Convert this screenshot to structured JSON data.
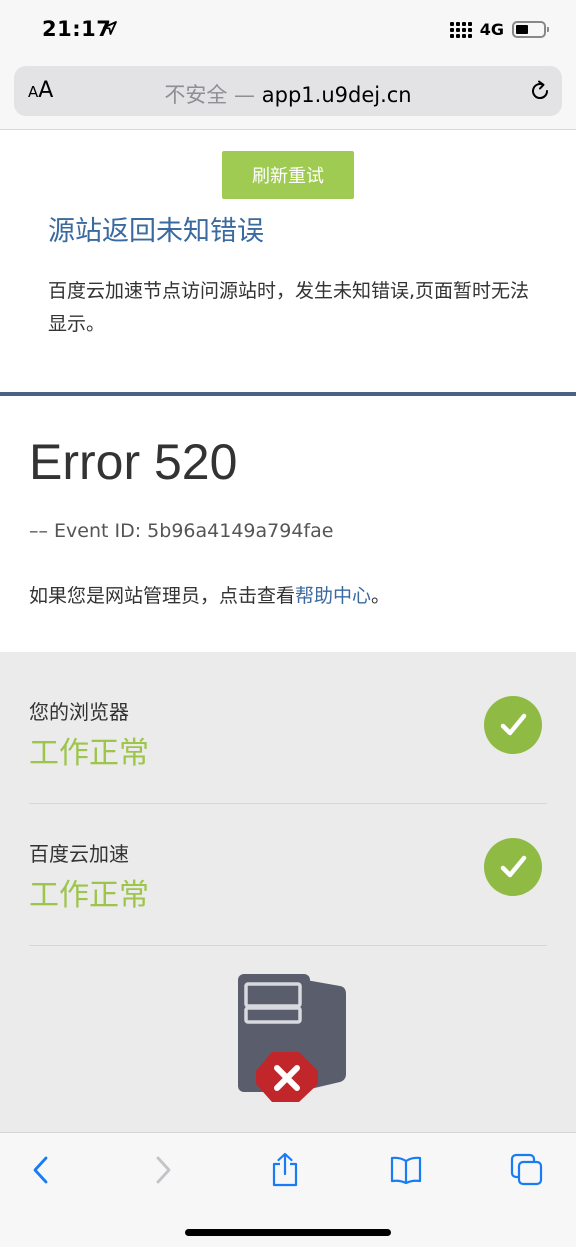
{
  "status_bar": {
    "time": "21:17",
    "network": "4G"
  },
  "address_bar": {
    "text_size_label": "AA",
    "insecure_label": "不安全 —",
    "host": "app1.u9dej.cn"
  },
  "origin_error": {
    "retry_button": "刷新重试",
    "title": "源站返回未知错误",
    "description": "百度云加速节点访问源站时，发生未知错误,页面暂时无法显示。"
  },
  "error": {
    "title": "Error 520",
    "event_id": "–– Event ID: 5b96a4149a794fae",
    "admin_prefix": "如果您是网站管理员，点击查看",
    "help_link": "帮助中心",
    "admin_suffix": "。"
  },
  "status_rows": [
    {
      "name": "您的浏览器",
      "status": "工作正常",
      "icon": "check-icon"
    },
    {
      "name": "百度云加速",
      "status": "工作正常",
      "icon": "check-icon"
    }
  ],
  "origin_server": {
    "icon": "server-error-icon"
  },
  "toolbar": {
    "items": [
      "back-icon",
      "forward-icon",
      "share-icon",
      "bookmarks-icon",
      "tabs-icon"
    ]
  },
  "colors": {
    "accent_green": "#a0cb52",
    "link_blue": "#3a6a9f",
    "status_green": "#9dc54a",
    "ios_blue": "#1a7cf5"
  }
}
